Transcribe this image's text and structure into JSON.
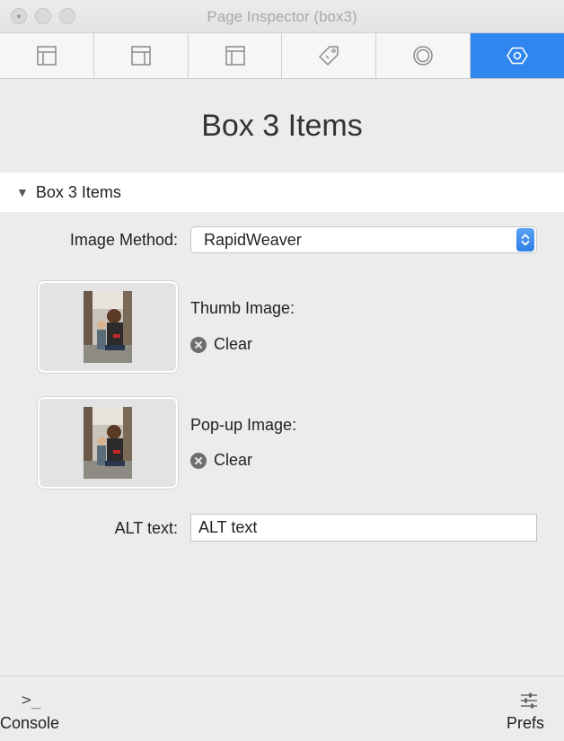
{
  "window": {
    "title": "Page Inspector (box3)"
  },
  "toolbar": {
    "tabs": [
      {
        "icon": "layout-icon"
      },
      {
        "icon": "layout-sidebar-icon"
      },
      {
        "icon": "layout-header-icon"
      },
      {
        "icon": "tag-icon"
      },
      {
        "icon": "circle-icon"
      },
      {
        "icon": "hexagon-icon",
        "active": true
      }
    ],
    "active_color": "#2f86ee"
  },
  "header": {
    "title": "Box 3 Items"
  },
  "section": {
    "title": "Box 3 Items"
  },
  "form": {
    "image_method_label": "Image Method:",
    "image_method_value": "RapidWeaver",
    "thumb_label": "Thumb Image:",
    "thumb_clear": "Clear",
    "popup_label": "Pop-up Image:",
    "popup_clear": "Clear",
    "alt_label": "ALT text:",
    "alt_value": "ALT text"
  },
  "footer": {
    "console_label": "Console",
    "prefs_label": "Prefs"
  }
}
